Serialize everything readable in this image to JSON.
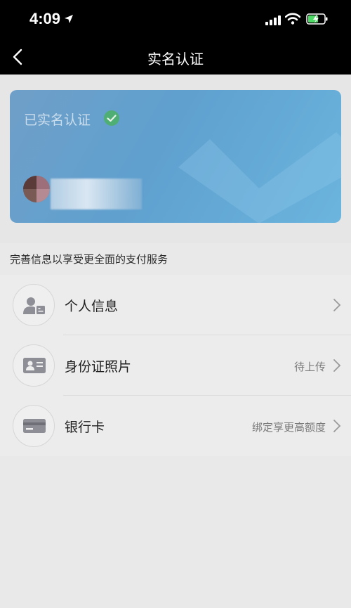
{
  "status_bar": {
    "time": "4:09"
  },
  "nav": {
    "title": "实名认证"
  },
  "card": {
    "status": "已实名认证"
  },
  "section_title": "完善信息以享受更全面的支付服务",
  "items": [
    {
      "label": "个人信息",
      "status": "",
      "icon": "person-id-icon"
    },
    {
      "label": "身份证照片",
      "status": "待上传",
      "icon": "id-card-icon"
    },
    {
      "label": "银行卡",
      "status": "绑定享更高额度",
      "icon": "bank-card-icon"
    }
  ],
  "colors": {
    "card_gradient_start": "#6f9fc8",
    "card_gradient_end": "#6bb5de",
    "verified_green": "#4caf6a",
    "battery_green": "#4cd964"
  }
}
